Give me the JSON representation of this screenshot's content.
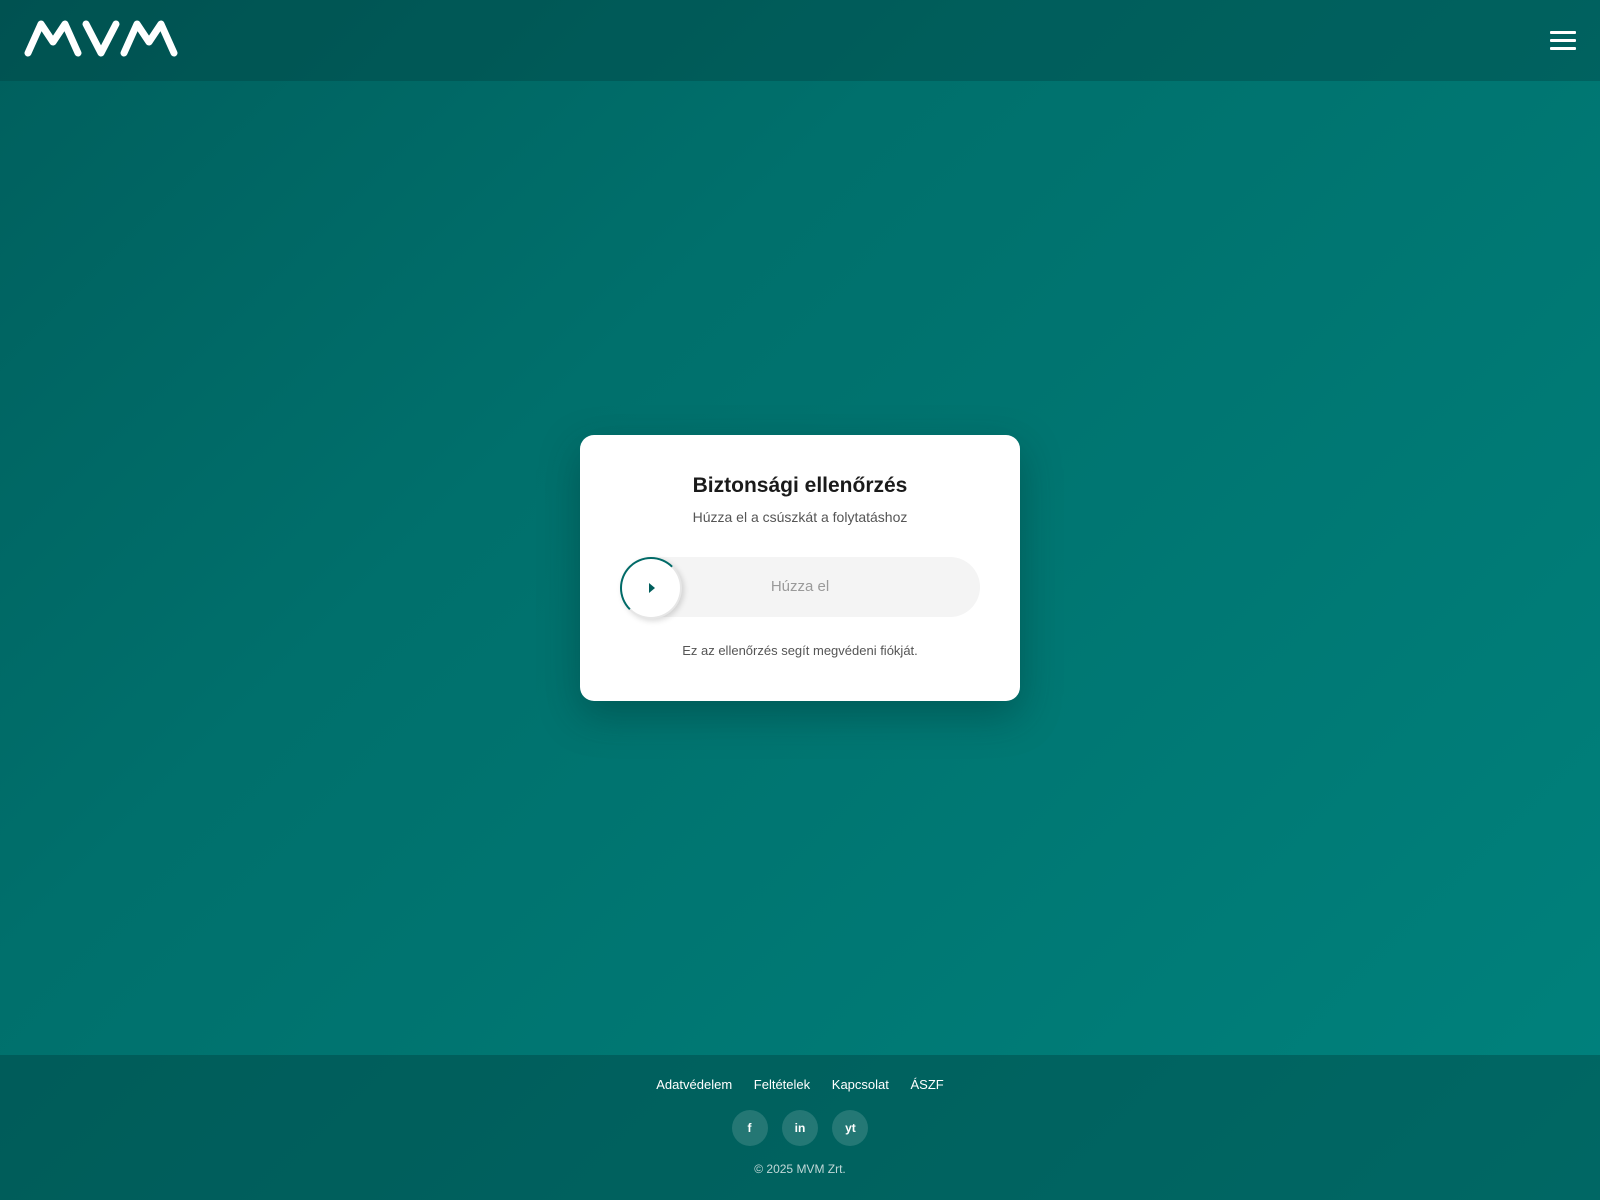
{
  "header": {
    "logo_text": "MVM",
    "menu_icon": "hamburger-menu-icon"
  },
  "verification": {
    "title": "Biztonsági ellenőrzés",
    "subtitle": "Húzza el a csúszkát a folytatáshoz",
    "slider": {
      "label": "Húzza el",
      "progress": 0,
      "handle_icon": "play-arrow-icon"
    },
    "note": "Ez az ellenőrzés segít megvédeni fiókját."
  },
  "footer": {
    "links": [
      "Adatvédelem",
      "Feltételek",
      "Kapcsolat",
      "ÁSZF"
    ],
    "socials": [
      {
        "label": "f",
        "icon": "facebook-icon"
      },
      {
        "label": "in",
        "icon": "linkedin-icon"
      },
      {
        "label": "yt",
        "icon": "youtube-icon"
      }
    ],
    "copyright": "© 2025 MVM Zrt."
  },
  "colors": {
    "brand_teal": "#006a67",
    "background_start": "#005f5d",
    "background_end": "#00827d",
    "card_background": "#ffffff"
  }
}
